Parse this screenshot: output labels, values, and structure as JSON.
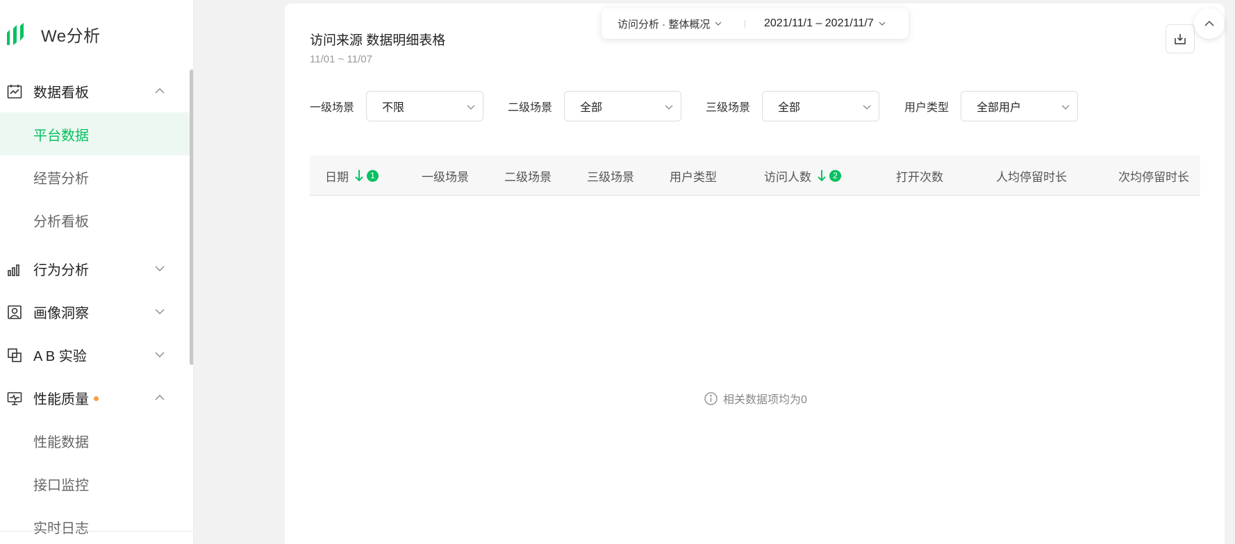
{
  "app": {
    "name": "We分析"
  },
  "sidebar": {
    "groups": [
      {
        "label": "数据看板",
        "icon": "dashboard-icon",
        "expanded": true,
        "items": [
          {
            "label": "平台数据",
            "active": true
          },
          {
            "label": "经营分析",
            "active": false
          },
          {
            "label": "分析看板",
            "active": false
          }
        ]
      },
      {
        "label": "行为分析",
        "icon": "bar-chart-icon",
        "expanded": false,
        "items": []
      },
      {
        "label": "画像洞察",
        "icon": "portrait-icon",
        "expanded": false,
        "items": []
      },
      {
        "label": "A B 实验",
        "icon": "ab-test-icon",
        "expanded": false,
        "items": []
      },
      {
        "label": "性能质量",
        "icon": "monitor-icon",
        "expanded": true,
        "has_dot": true,
        "items": [
          {
            "label": "性能数据",
            "active": false
          },
          {
            "label": "接口监控",
            "active": false
          },
          {
            "label": "实时日志",
            "active": false
          }
        ]
      }
    ]
  },
  "topbar": {
    "analysis_label": "访问分析 · 整体概况",
    "date_range": "2021/11/1 – 2021/11/7"
  },
  "card": {
    "title": "访问来源 数据明细表格",
    "subtitle": "11/01 ~ 11/07"
  },
  "filters": [
    {
      "label": "一级场景",
      "value": "不限"
    },
    {
      "label": "二级场景",
      "value": "全部"
    },
    {
      "label": "三级场景",
      "value": "全部"
    },
    {
      "label": "用户类型",
      "value": "全部用户"
    }
  ],
  "table": {
    "columns": [
      {
        "label": "日期",
        "sort": "desc",
        "badge": "1"
      },
      {
        "label": "一级场景"
      },
      {
        "label": "二级场景"
      },
      {
        "label": "三级场景"
      },
      {
        "label": "用户类型"
      },
      {
        "label": "访问人数",
        "sort": "desc",
        "badge": "2"
      },
      {
        "label": "打开次数"
      },
      {
        "label": "人均停留时长"
      },
      {
        "label": "次均停留时长"
      }
    ],
    "empty_text": "相关数据项均为0"
  },
  "colors": {
    "accent": "#07c160",
    "dot": "#fa9d3b",
    "background": "#f2f2f2"
  }
}
